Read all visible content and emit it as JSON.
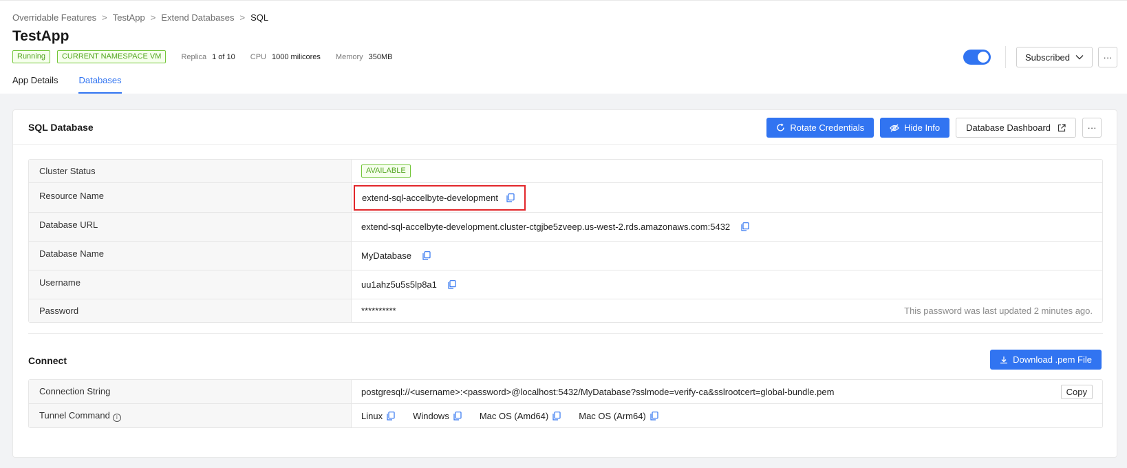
{
  "breadcrumb": {
    "items": [
      "Overridable Features",
      "TestApp",
      "Extend Databases"
    ],
    "current": "SQL",
    "separator": ">"
  },
  "app": {
    "title": "TestApp",
    "status": "Running",
    "namespace": "CURRENT NAMESPACE VM",
    "replica_label": "Replica",
    "replica_value": "1 of 10",
    "cpu_label": "CPU",
    "cpu_value": "1000 milicores",
    "memory_label": "Memory",
    "memory_value": "350MB"
  },
  "header_actions": {
    "subscribed_label": "Subscribed",
    "more_label": "···",
    "toggle_on": true
  },
  "tabs": [
    {
      "label": "App Details",
      "active": false
    },
    {
      "label": "Databases",
      "active": true
    }
  ],
  "sql_card": {
    "title": "SQL Database",
    "rotate_label": "Rotate Credentials",
    "hide_label": "Hide Info",
    "dashboard_label": "Database Dashboard",
    "more_label": "···",
    "rows": {
      "cluster_status": {
        "key": "Cluster Status",
        "value": "AVAILABLE"
      },
      "resource_name": {
        "key": "Resource Name",
        "value": "extend-sql-accelbyte-development"
      },
      "database_url": {
        "key": "Database URL",
        "value": "extend-sql-accelbyte-development.cluster-ctgjbe5zveep.us-west-2.rds.amazonaws.com:5432"
      },
      "database_name": {
        "key": "Database Name",
        "value": "MyDatabase"
      },
      "username": {
        "key": "Username",
        "value": "uu1ahz5u5s5lp8a1"
      },
      "password": {
        "key": "Password",
        "value": "**********",
        "note": "This password was last updated 2 minutes ago."
      }
    }
  },
  "connect": {
    "title": "Connect",
    "download_label": "Download .pem File",
    "connection_string_key": "Connection String",
    "connection_string_value": "postgresql://<username>:<password>@localhost:5432/MyDatabase?sslmode=verify-ca&sslrootcert=global-bundle.pem",
    "copy_label": "Copy",
    "tunnel_key": "Tunnel Command",
    "tunnel_info_glyph": "i",
    "os_options": [
      "Linux",
      "Windows",
      "Mac OS (Amd64)",
      "Mac OS (Arm64)"
    ]
  },
  "colors": {
    "primary": "#3174f1",
    "success_border": "#73c639",
    "highlight": "#e2262a"
  }
}
